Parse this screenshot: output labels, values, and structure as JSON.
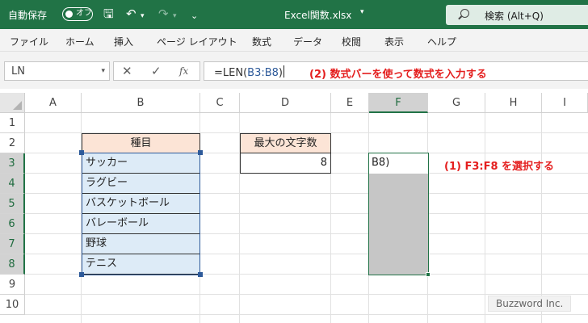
{
  "titlebar": {
    "autosave_label": "自動保存",
    "toggle_label": "オフ",
    "filename": "Excel関数.xlsx",
    "search_placeholder": "検索 (Alt+Q)",
    "accent_color": "#217346"
  },
  "menu": [
    "ファイル",
    "ホーム",
    "挿入",
    "ページ レイアウト",
    "数式",
    "データ",
    "校閲",
    "表示",
    "ヘルプ"
  ],
  "formula_bar": {
    "name_box": "LN",
    "cancel_icon": "✕",
    "enter_icon": "✓",
    "fx_label": "fx",
    "formula_prefix": "=LEN(",
    "formula_ref": "B3:B8",
    "formula_suffix": ")",
    "note": "(2) 数式バーを使って数式を入力する"
  },
  "columns": [
    "A",
    "B",
    "C",
    "D",
    "E",
    "F",
    "G",
    "H",
    "I"
  ],
  "rows": [
    "1",
    "2",
    "3",
    "4",
    "5",
    "6",
    "7",
    "8",
    "9",
    "10"
  ],
  "cells": {
    "b2": "種目",
    "items": [
      "サッカー",
      "ラグビー",
      "バスケットボール",
      "バレーボール",
      "野球",
      "テニス"
    ],
    "d2": "最大の文字数",
    "d3": "8",
    "f3": "B8)"
  },
  "annotation": "(1) F3:F8 を選択する",
  "watermark": "Buzzword Inc."
}
